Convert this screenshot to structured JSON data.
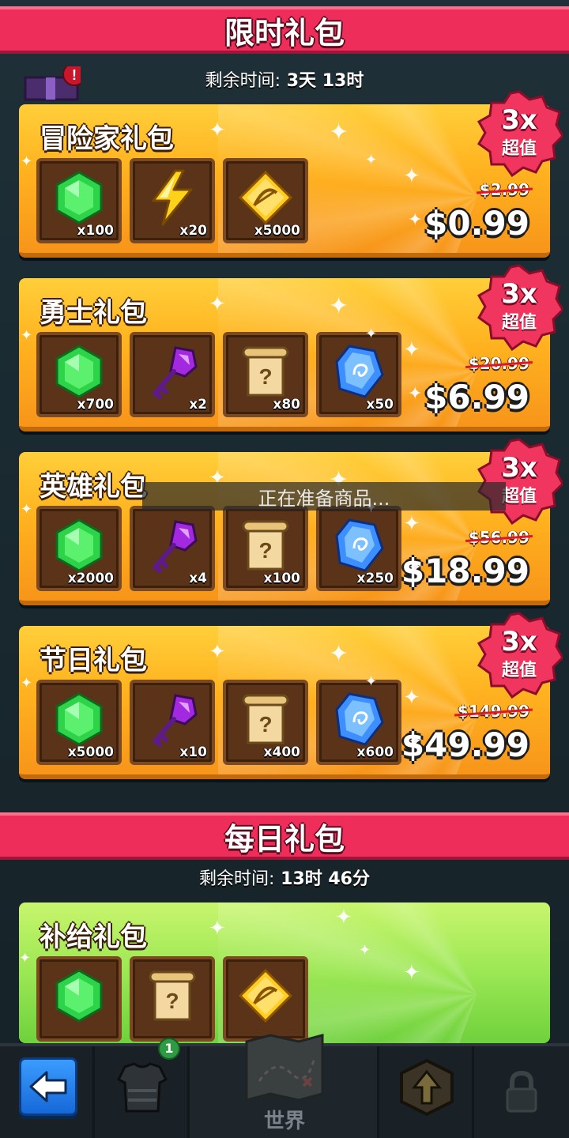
{
  "limited_section": {
    "title": "限时礼包",
    "timer_label": "剩余时间:",
    "timer_value": "3天 13时"
  },
  "packs": [
    {
      "name": "冒险家礼包",
      "badge_multiplier": "3x",
      "badge_text": "超值",
      "old_price": "$2.99",
      "price": "$0.99",
      "items": [
        {
          "icon": "green-gem-icon",
          "qty": "x100"
        },
        {
          "icon": "lightning-bolt-icon",
          "qty": "x20"
        },
        {
          "icon": "gold-bow-coin-icon",
          "qty": "x5000"
        }
      ]
    },
    {
      "name": "勇士礼包",
      "badge_multiplier": "3x",
      "badge_text": "超值",
      "old_price": "$20.99",
      "price": "$6.99",
      "items": [
        {
          "icon": "green-gem-icon",
          "qty": "x700"
        },
        {
          "icon": "purple-key-icon",
          "qty": "x2"
        },
        {
          "icon": "mystery-scroll-icon",
          "qty": "x80"
        },
        {
          "icon": "blue-rune-crystal-icon",
          "qty": "x50"
        }
      ]
    },
    {
      "name": "英雄礼包",
      "badge_multiplier": "3x",
      "badge_text": "超值",
      "old_price": "$56.99",
      "price": "$18.99",
      "items": [
        {
          "icon": "green-gem-icon",
          "qty": "x2000"
        },
        {
          "icon": "purple-key-icon",
          "qty": "x4"
        },
        {
          "icon": "mystery-scroll-icon",
          "qty": "x100"
        },
        {
          "icon": "blue-rune-crystal-icon",
          "qty": "x250"
        }
      ]
    },
    {
      "name": "节日礼包",
      "badge_multiplier": "3x",
      "badge_text": "超值",
      "old_price": "$149.99",
      "price": "$49.99",
      "items": [
        {
          "icon": "green-gem-icon",
          "qty": "x5000"
        },
        {
          "icon": "purple-key-icon",
          "qty": "x10"
        },
        {
          "icon": "mystery-scroll-icon",
          "qty": "x400"
        },
        {
          "icon": "blue-rune-crystal-icon",
          "qty": "x600"
        }
      ]
    }
  ],
  "toast": {
    "text": "正在准备商品..."
  },
  "daily_section": {
    "title": "每日礼包",
    "timer_label": "剩余时间:",
    "timer_value": "13时 46分"
  },
  "daily_pack": {
    "name": "补给礼包",
    "items": [
      {
        "icon": "green-gem-icon"
      },
      {
        "icon": "mystery-scroll-icon"
      },
      {
        "icon": "gold-bow-coin-icon"
      }
    ]
  },
  "bottom_nav": {
    "back_icon": "arrow-left-icon",
    "armor_badge": "1",
    "world_label": "世界",
    "upgrade_icon": "up-arrow-shield-icon",
    "locked_icon": "lock-icon"
  },
  "colors": {
    "banner_red": "#ee2d5a",
    "pack_orange": "#ffb21f",
    "daily_green": "#9be754",
    "badge_pink": "#f0365f"
  }
}
